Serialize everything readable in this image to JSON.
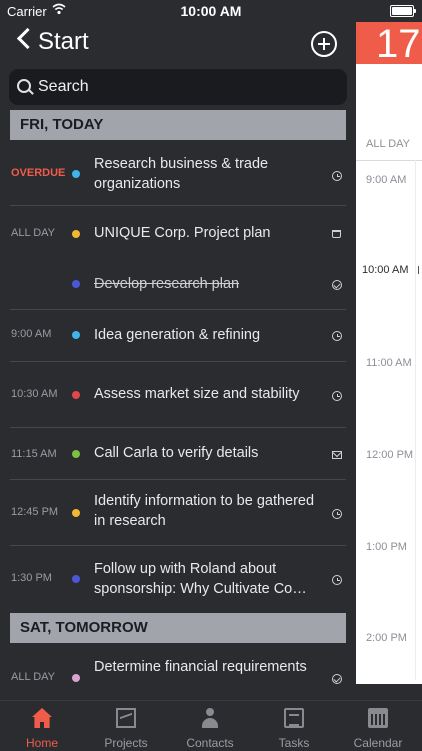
{
  "status_bar": {
    "carrier": "Carrier",
    "time": "10:00 AM"
  },
  "nav": {
    "back_label": "Start"
  },
  "search": {
    "placeholder": "Search"
  },
  "sections": [
    {
      "header": "FRI, TODAY",
      "items": [
        {
          "time": "OVERDUE",
          "dot_color": "#3fb6e8",
          "title": "Research business & trade organizations",
          "icon": "clock-icon",
          "completed": false
        },
        {
          "time": "ALL DAY",
          "dot_color": "#f2b632",
          "title": "UNIQUE Corp. Project plan",
          "icon": "cart-icon",
          "completed": false
        },
        {
          "time": "",
          "dot_color": "#4a58d8",
          "title": "Develop research plan",
          "icon": "check-circle-icon",
          "completed": true
        },
        {
          "time": "9:00 AM",
          "dot_color": "#3fb6e8",
          "title": "Idea generation & refining",
          "icon": "clock-icon",
          "completed": false
        },
        {
          "time": "10:30 AM",
          "dot_color": "#e0484c",
          "title": "Assess market size and stability",
          "icon": "clock-icon",
          "completed": false
        },
        {
          "time": "11:15 AM",
          "dot_color": "#7bc142",
          "title": "Call Carla to verify details",
          "icon": "mail-icon",
          "completed": false
        },
        {
          "time": "12:45 PM",
          "dot_color": "#f2b632",
          "title": "Identify information to be gathered in research",
          "icon": "clock-icon",
          "completed": false
        },
        {
          "time": "1:30 PM",
          "dot_color": "#4a58d8",
          "title": "Follow up with Roland about sponsorship: Why Cultivate Co…",
          "icon": "clock-icon",
          "completed": false
        }
      ]
    },
    {
      "header": "SAT, TOMORROW",
      "items": [
        {
          "time": "ALL DAY",
          "dot_color": "#d9a3d3",
          "title": "Determine financial requirements",
          "icon": "check-circle-icon",
          "completed": false
        }
      ]
    }
  ],
  "calendar": {
    "day_number": "17",
    "all_day_label": "ALL DAY",
    "hours": [
      "9:00 AM",
      "10:00 AM",
      "11:00 AM",
      "12:00 PM",
      "1:00 PM",
      "2:00 PM"
    ],
    "accent": "#ef5d4a"
  },
  "tabbar": {
    "tabs": [
      {
        "label": "Home",
        "icon": "home-icon",
        "active": true
      },
      {
        "label": "Projects",
        "icon": "projects-icon",
        "active": false
      },
      {
        "label": "Contacts",
        "icon": "contacts-icon",
        "active": false
      },
      {
        "label": "Tasks",
        "icon": "tasks-icon",
        "active": false
      },
      {
        "label": "Calendar",
        "icon": "calendar-icon",
        "active": false
      }
    ]
  }
}
